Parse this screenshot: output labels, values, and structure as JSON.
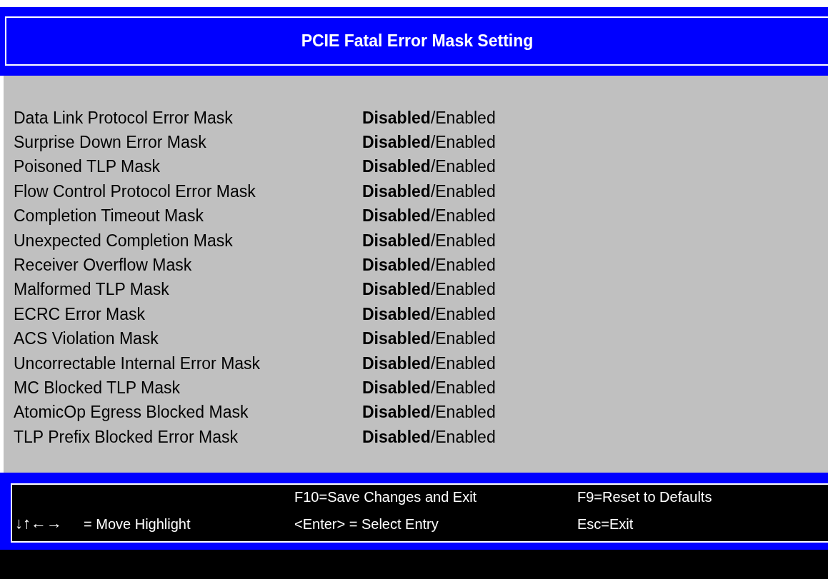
{
  "title": "PCIE Fatal Error Mask Setting",
  "separator": "/",
  "settings": [
    {
      "label": "Data Link Protocol Error Mask",
      "options": [
        {
          "label": "Disabled",
          "selected": true
        },
        {
          "label": "Enabled",
          "selected": false
        }
      ]
    },
    {
      "label": "Surprise Down Error Mask",
      "options": [
        {
          "label": "Disabled",
          "selected": true
        },
        {
          "label": "Enabled",
          "selected": false
        }
      ]
    },
    {
      "label": "Poisoned TLP Mask",
      "options": [
        {
          "label": "Disabled",
          "selected": true
        },
        {
          "label": "Enabled",
          "selected": false
        }
      ]
    },
    {
      "label": "Flow Control Protocol Error Mask",
      "options": [
        {
          "label": "Disabled",
          "selected": true
        },
        {
          "label": "Enabled",
          "selected": false
        }
      ]
    },
    {
      "label": "Completion Timeout Mask",
      "options": [
        {
          "label": "Disabled",
          "selected": true
        },
        {
          "label": "Enabled",
          "selected": false
        }
      ]
    },
    {
      "label": "Unexpected Completion Mask",
      "options": [
        {
          "label": "Disabled",
          "selected": true
        },
        {
          "label": "Enabled",
          "selected": false
        }
      ]
    },
    {
      "label": "Receiver Overflow Mask",
      "options": [
        {
          "label": "Disabled",
          "selected": true
        },
        {
          "label": "Enabled",
          "selected": false
        }
      ]
    },
    {
      "label": "Malformed TLP Mask",
      "options": [
        {
          "label": "Disabled",
          "selected": true
        },
        {
          "label": "Enabled",
          "selected": false
        }
      ]
    },
    {
      "label": "ECRC Error Mask",
      "options": [
        {
          "label": "Disabled",
          "selected": true
        },
        {
          "label": "Enabled",
          "selected": false
        }
      ]
    },
    {
      "label": "ACS Violation Mask",
      "options": [
        {
          "label": "Disabled",
          "selected": true
        },
        {
          "label": "Enabled",
          "selected": false
        }
      ]
    },
    {
      "label": "Uncorrectable Internal Error Mask",
      "options": [
        {
          "label": "Disabled",
          "selected": true
        },
        {
          "label": "Enabled",
          "selected": false
        }
      ]
    },
    {
      "label": "MC Blocked TLP Mask",
      "options": [
        {
          "label": "Disabled",
          "selected": true
        },
        {
          "label": "Enabled",
          "selected": false
        }
      ]
    },
    {
      "label": "AtomicOp Egress Blocked Mask",
      "options": [
        {
          "label": "Disabled",
          "selected": true
        },
        {
          "label": "Enabled",
          "selected": false
        }
      ]
    },
    {
      "label": "TLP Prefix Blocked Error Mask",
      "options": [
        {
          "label": "Disabled",
          "selected": true
        },
        {
          "label": "Enabled",
          "selected": false
        }
      ]
    }
  ],
  "help_bar": {
    "keys": "↓↑←→",
    "move": "= Move Highlight",
    "save": "F10=Save Changes and Exit",
    "select": "<Enter> = Select Entry",
    "reset": "F9=Reset to Defaults",
    "exit": "Esc=Exit"
  }
}
